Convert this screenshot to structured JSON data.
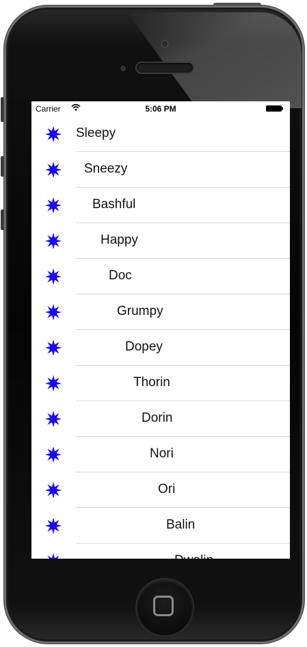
{
  "status_bar": {
    "carrier": "Carrier",
    "time": "5:06 PM",
    "wifi_icon": "wifi-icon",
    "battery_icon": "battery-icon"
  },
  "list": {
    "icon": "star-icon",
    "icon_color": "#1a0af0",
    "items": [
      "Sleepy",
      "Sneezy",
      "Bashful",
      "Happy",
      "Doc",
      "Grumpy",
      "Dopey",
      "Thorin",
      "Dorin",
      "Nori",
      "Ori",
      "Balin",
      "Dwalin"
    ]
  }
}
